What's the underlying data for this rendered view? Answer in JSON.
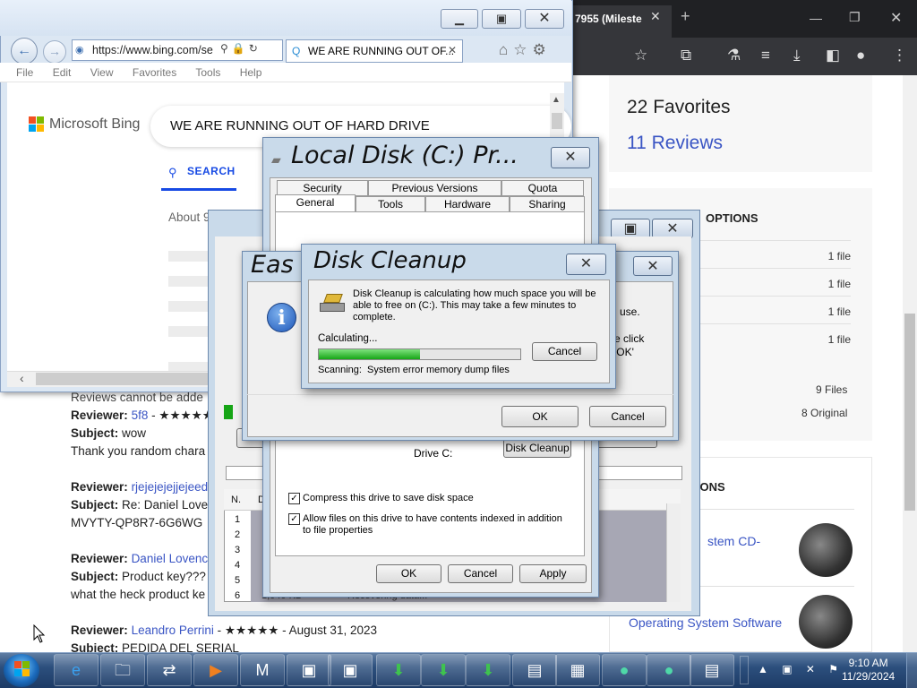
{
  "chrome": {
    "tab_title": "7955 (Mileste",
    "favorites": "22 Favorites",
    "reviews": "11 Reviews",
    "options_title": "OPTIONS",
    "file_rows": [
      "1 file",
      "1 file",
      "1 file",
      "1 file"
    ],
    "files_total": "9 Files",
    "original_total": "8 Original",
    "options2_title": "TIONS",
    "os_cd": "stem CD-",
    "os_software": "Operating System Software"
  },
  "reviews": {
    "cannot_add": "Reviews cannot be adde",
    "r1_label": "Reviewer:",
    "r1_name": "5f8",
    "r1_stars": "- ★★★★★",
    "r1_subject_label": "Subject:",
    "r1_subject": "wow",
    "r1_body": "Thank you random chara",
    "r2_label": "Reviewer:",
    "r2_name": "rjejejejejjejeed",
    "r2_subject_label": "Subject:",
    "r2_subject": "Re: Daniel Love",
    "r2_body": "MVYTY-QP8R7-6G6WG",
    "r3_label": "Reviewer:",
    "r3_name": "Daniel Lovenc",
    "r3_subject_label": "Subject:",
    "r3_subject": "Product key???",
    "r3_body": "what the heck product ke",
    "r4_label": "Reviewer:",
    "r4_name": "Leandro Perrini",
    "r4_rest": "- ★★★★★ - August 31, 2023",
    "r4_subject_label": "Subject:",
    "r4_subject": "PEDIDA DEL SERIAL"
  },
  "ie": {
    "url": "https://www.bing.com/se",
    "tab_title": "WE ARE RUNNING OUT OF...",
    "menu": [
      "File",
      "Edit",
      "View",
      "Favorites",
      "Tools",
      "Help"
    ],
    "bing_logo": "Microsoft Bing",
    "search_query": "WE ARE RUNNING OUT OF HARD DRIVE",
    "search_tab": "SEARCH",
    "results_count": "About 9,030,000"
  },
  "props": {
    "title": "Local Disk (C:) Pr...",
    "tabs_row1": [
      "Security",
      "Previous Versions",
      "Quota"
    ],
    "tabs_row2": [
      "General",
      "Tools",
      "Hardware",
      "Sharing"
    ],
    "drive_label": "Drive C:",
    "disk_cleanup_btn": "Disk Cleanup",
    "compress_label": "Compress this drive to save disk space",
    "index_label": "Allow files on this drive to have contents indexed in addition to file properties",
    "ok": "OK",
    "cancel": "Cancel",
    "apply": "Apply"
  },
  "dcmgr": {
    "col_n": "N.",
    "col_d": "D",
    "rows": [
      "1",
      "2",
      "3",
      "4",
      "5",
      "6"
    ],
    "row6_size": "1,040 KB",
    "row6_name": "Recovering data..."
  },
  "easy": {
    "title": "Eas",
    "text1": "l use.",
    "text2": "e click",
    "text3": "'OK'",
    "ok": "OK",
    "cancel": "Cancel"
  },
  "dcprog": {
    "title": "Disk Cleanup",
    "message": "Disk Cleanup is calculating how much space you will be able to free on  (C:). This may take a few minutes to complete.",
    "calculating": "Calculating...",
    "progress_fraction": 0.5,
    "cancel": "Cancel",
    "scanning_label": "Scanning:",
    "scanning_item": "System error memory dump files"
  },
  "taskbar": {
    "time": "9:10 AM",
    "date": "11/29/2024"
  },
  "colors": {
    "link": "#3a55c4",
    "progress": "#16a516",
    "bing_blue": "#174ae4"
  }
}
